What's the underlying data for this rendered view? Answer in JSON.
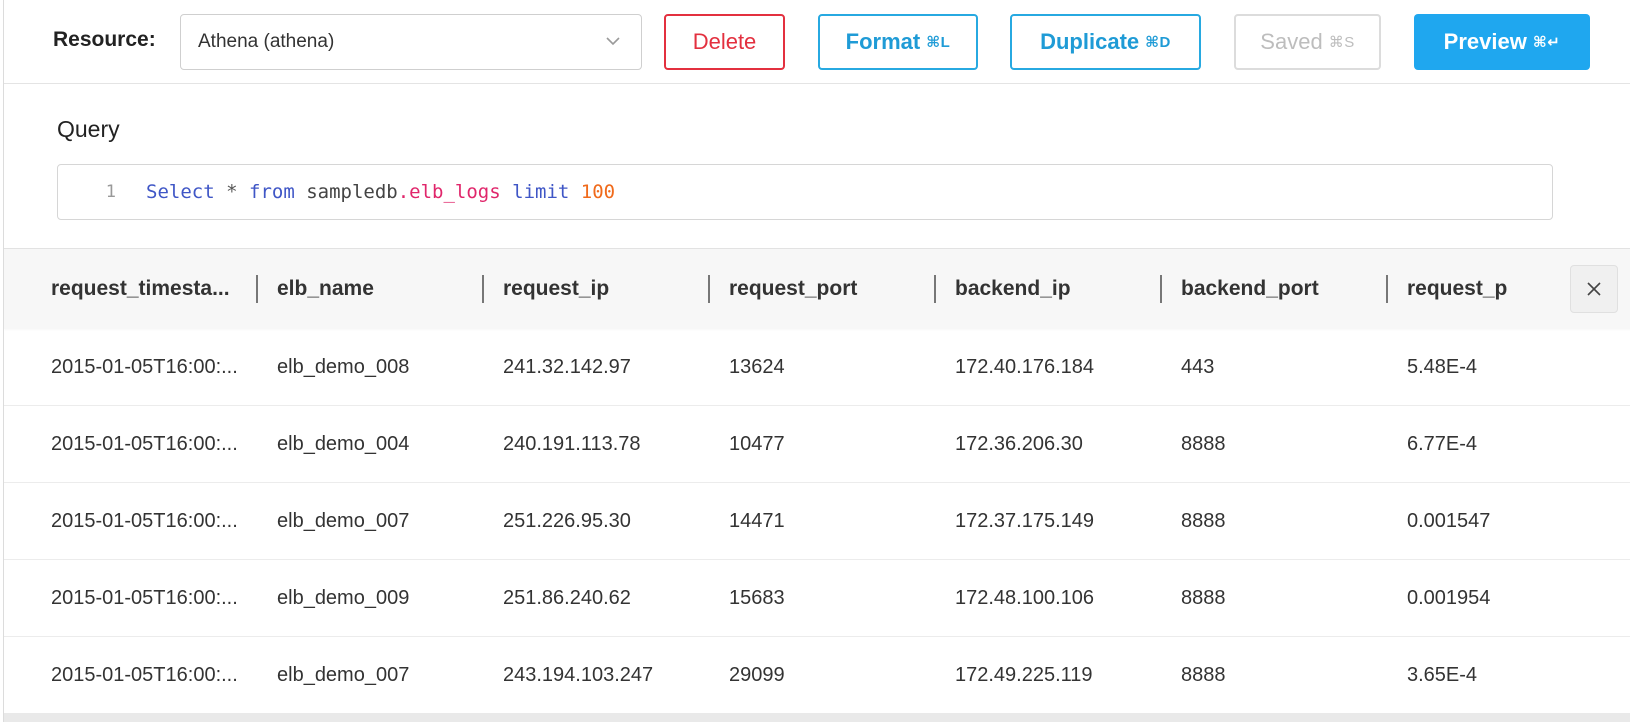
{
  "toolbar": {
    "resource_label": "Resource:",
    "resource_value": "Athena (athena)",
    "delete_label": "Delete",
    "format_label": "Format",
    "format_kbd": "⌘L",
    "duplicate_label": "Duplicate",
    "duplicate_kbd": "⌘D",
    "saved_label": "Saved",
    "saved_kbd": "⌘S",
    "preview_label": "Preview",
    "preview_kbd": "⌘↵"
  },
  "query": {
    "title": "Query",
    "line_number": "1",
    "tokens": {
      "select": "Select",
      "star": "*",
      "from": "from",
      "schema": "sampledb",
      "table": ".elb_logs",
      "limit": "limit",
      "limit_value": "100"
    }
  },
  "table": {
    "columns": [
      "request_timesta...",
      "elb_name",
      "request_ip",
      "request_port",
      "backend_ip",
      "backend_port",
      "request_p"
    ],
    "rows": [
      [
        "2015-01-05T16:00:...",
        "elb_demo_008",
        "241.32.142.97",
        "13624",
        "172.40.176.184",
        "443",
        "5.48E-4"
      ],
      [
        "2015-01-05T16:00:...",
        "elb_demo_004",
        "240.191.113.78",
        "10477",
        "172.36.206.30",
        "8888",
        "6.77E-4"
      ],
      [
        "2015-01-05T16:00:...",
        "elb_demo_007",
        "251.226.95.30",
        "14471",
        "172.37.175.149",
        "8888",
        "0.001547"
      ],
      [
        "2015-01-05T16:00:...",
        "elb_demo_009",
        "251.86.240.62",
        "15683",
        "172.48.100.106",
        "8888",
        "0.001954"
      ],
      [
        "2015-01-05T16:00:...",
        "elb_demo_007",
        "243.194.103.247",
        "29099",
        "172.49.225.119",
        "8888",
        "3.65E-4"
      ]
    ]
  },
  "colors": {
    "delete": "#e3303f",
    "accent": "#27a9e1",
    "primary": "#1fa7ef",
    "disabled": "#bdbdbd"
  },
  "icons": {
    "resource_dropdown": "chevron-down-icon",
    "close_results": "close-icon"
  }
}
